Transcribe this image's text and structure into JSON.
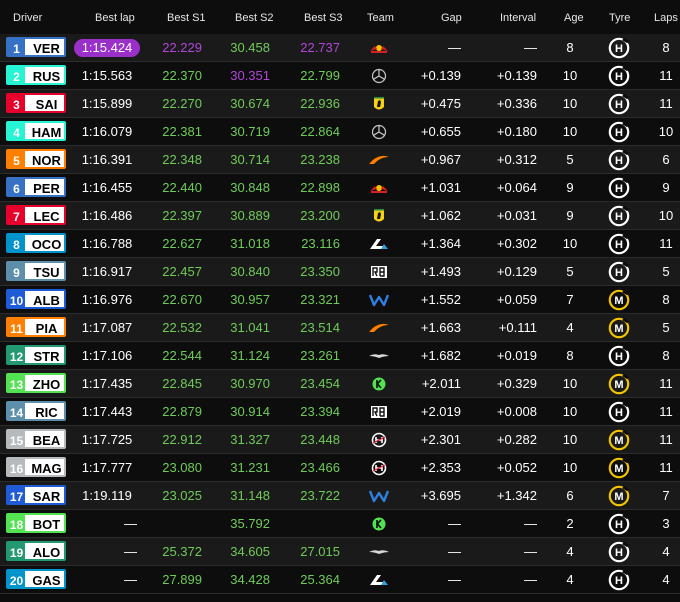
{
  "headers": {
    "driver": "Driver",
    "best_lap": "Best lap",
    "best_s1": "Best S1",
    "best_s2": "Best S2",
    "best_s3": "Best S3",
    "team": "Team",
    "gap": "Gap",
    "interval": "Interval",
    "age": "Age",
    "tyre": "Tyre",
    "laps": "Laps"
  },
  "team_colors": {
    "red_bull": "#3671c6",
    "mercedes": "#27f4d2",
    "ferrari": "#e8002d",
    "mclaren": "#ff8000",
    "alpine": "#0093cc",
    "rb": "#5e8faa",
    "williams": "#1f5bd6",
    "aston_martin": "#229971",
    "kick_sauber": "#52e252",
    "haas": "#b6babd"
  },
  "sector_colors": {
    "personal_best": "#6fcb59",
    "overall_best": "#b146d9",
    "normal": "#ffffff"
  },
  "tyre_colors": {
    "H": "#ffffff",
    "M": "#f5c400"
  },
  "rows": [
    {
      "pos": "1",
      "code": "VER",
      "team": "red_bull",
      "best": "1:15.424",
      "best_fastest": true,
      "s1": "22.229",
      "s1c": "overall_best",
      "s2": "30.458",
      "s2c": "personal_best",
      "s3": "22.737",
      "s3c": "overall_best",
      "gap": "—",
      "int": "—",
      "age": "8",
      "tyre": "H",
      "laps": "8"
    },
    {
      "pos": "2",
      "code": "RUS",
      "team": "mercedes",
      "best": "1:15.563",
      "s1": "22.370",
      "s1c": "personal_best",
      "s2": "30.351",
      "s2c": "overall_best",
      "s3": "22.799",
      "s3c": "personal_best",
      "gap": "+0.139",
      "int": "+0.139",
      "age": "10",
      "tyre": "H",
      "laps": "11"
    },
    {
      "pos": "3",
      "code": "SAI",
      "team": "ferrari",
      "best": "1:15.899",
      "s1": "22.270",
      "s1c": "personal_best",
      "s2": "30.674",
      "s2c": "personal_best",
      "s3": "22.936",
      "s3c": "personal_best",
      "gap": "+0.475",
      "int": "+0.336",
      "age": "10",
      "tyre": "H",
      "laps": "11"
    },
    {
      "pos": "4",
      "code": "HAM",
      "team": "mercedes",
      "best": "1:16.079",
      "s1": "22.381",
      "s1c": "personal_best",
      "s2": "30.719",
      "s2c": "personal_best",
      "s3": "22.864",
      "s3c": "personal_best",
      "gap": "+0.655",
      "int": "+0.180",
      "age": "10",
      "tyre": "H",
      "laps": "10"
    },
    {
      "pos": "5",
      "code": "NOR",
      "team": "mclaren",
      "best": "1:16.391",
      "s1": "22.348",
      "s1c": "personal_best",
      "s2": "30.714",
      "s2c": "personal_best",
      "s3": "23.238",
      "s3c": "personal_best",
      "gap": "+0.967",
      "int": "+0.312",
      "age": "5",
      "tyre": "H",
      "laps": "6"
    },
    {
      "pos": "6",
      "code": "PER",
      "team": "red_bull",
      "best": "1:16.455",
      "s1": "22.440",
      "s1c": "personal_best",
      "s2": "30.848",
      "s2c": "personal_best",
      "s3": "22.898",
      "s3c": "personal_best",
      "gap": "+1.031",
      "int": "+0.064",
      "age": "9",
      "tyre": "H",
      "laps": "9"
    },
    {
      "pos": "7",
      "code": "LEC",
      "team": "ferrari",
      "best": "1:16.486",
      "s1": "22.397",
      "s1c": "personal_best",
      "s2": "30.889",
      "s2c": "personal_best",
      "s3": "23.200",
      "s3c": "personal_best",
      "gap": "+1.062",
      "int": "+0.031",
      "age": "9",
      "tyre": "H",
      "laps": "10"
    },
    {
      "pos": "8",
      "code": "OCO",
      "team": "alpine",
      "best": "1:16.788",
      "s1": "22.627",
      "s1c": "personal_best",
      "s2": "31.018",
      "s2c": "personal_best",
      "s3": "23.116",
      "s3c": "personal_best",
      "gap": "+1.364",
      "int": "+0.302",
      "age": "10",
      "tyre": "H",
      "laps": "11"
    },
    {
      "pos": "9",
      "code": "TSU",
      "team": "rb",
      "best": "1:16.917",
      "s1": "22.457",
      "s1c": "personal_best",
      "s2": "30.840",
      "s2c": "personal_best",
      "s3": "23.350",
      "s3c": "personal_best",
      "gap": "+1.493",
      "int": "+0.129",
      "age": "5",
      "tyre": "H",
      "laps": "5"
    },
    {
      "pos": "10",
      "code": "ALB",
      "team": "williams",
      "best": "1:16.976",
      "s1": "22.670",
      "s1c": "personal_best",
      "s2": "30.957",
      "s2c": "personal_best",
      "s3": "23.321",
      "s3c": "personal_best",
      "gap": "+1.552",
      "int": "+0.059",
      "age": "7",
      "tyre": "M",
      "laps": "8"
    },
    {
      "pos": "11",
      "code": "PIA",
      "team": "mclaren",
      "best": "1:17.087",
      "s1": "22.532",
      "s1c": "personal_best",
      "s2": "31.041",
      "s2c": "personal_best",
      "s3": "23.514",
      "s3c": "personal_best",
      "gap": "+1.663",
      "int": "+0.111",
      "age": "4",
      "tyre": "M",
      "laps": "5"
    },
    {
      "pos": "12",
      "code": "STR",
      "team": "aston_martin",
      "best": "1:17.106",
      "s1": "22.544",
      "s1c": "personal_best",
      "s2": "31.124",
      "s2c": "personal_best",
      "s3": "23.261",
      "s3c": "personal_best",
      "gap": "+1.682",
      "int": "+0.019",
      "age": "8",
      "tyre": "H",
      "laps": "8"
    },
    {
      "pos": "13",
      "code": "ZHO",
      "team": "kick_sauber",
      "best": "1:17.435",
      "s1": "22.845",
      "s1c": "personal_best",
      "s2": "30.970",
      "s2c": "personal_best",
      "s3": "23.454",
      "s3c": "personal_best",
      "gap": "+2.011",
      "int": "+0.329",
      "age": "10",
      "tyre": "M",
      "laps": "11"
    },
    {
      "pos": "14",
      "code": "RIC",
      "team": "rb",
      "best": "1:17.443",
      "s1": "22.879",
      "s1c": "personal_best",
      "s2": "30.914",
      "s2c": "personal_best",
      "s3": "23.394",
      "s3c": "personal_best",
      "gap": "+2.019",
      "int": "+0.008",
      "age": "10",
      "tyre": "H",
      "laps": "11"
    },
    {
      "pos": "15",
      "code": "BEA",
      "team": "haas",
      "best": "1:17.725",
      "s1": "22.912",
      "s1c": "personal_best",
      "s2": "31.327",
      "s2c": "personal_best",
      "s3": "23.448",
      "s3c": "personal_best",
      "gap": "+2.301",
      "int": "+0.282",
      "age": "10",
      "tyre": "M",
      "laps": "11"
    },
    {
      "pos": "16",
      "code": "MAG",
      "team": "haas",
      "best": "1:17.777",
      "s1": "23.080",
      "s1c": "personal_best",
      "s2": "31.231",
      "s2c": "personal_best",
      "s3": "23.466",
      "s3c": "personal_best",
      "gap": "+2.353",
      "int": "+0.052",
      "age": "10",
      "tyre": "M",
      "laps": "11"
    },
    {
      "pos": "17",
      "code": "SAR",
      "team": "williams",
      "best": "1:19.119",
      "s1": "23.025",
      "s1c": "personal_best",
      "s2": "31.148",
      "s2c": "personal_best",
      "s3": "23.722",
      "s3c": "personal_best",
      "gap": "+3.695",
      "int": "+1.342",
      "age": "6",
      "tyre": "M",
      "laps": "7"
    },
    {
      "pos": "18",
      "code": "BOT",
      "team": "kick_sauber",
      "best": "—",
      "s1": "",
      "s1c": "personal_best",
      "s2": "35.792",
      "s2c": "personal_best",
      "s3": "",
      "s3c": "personal_best",
      "gap": "—",
      "int": "—",
      "age": "2",
      "tyre": "H",
      "laps": "3"
    },
    {
      "pos": "19",
      "code": "ALO",
      "team": "aston_martin",
      "best": "—",
      "s1": "25.372",
      "s1c": "personal_best",
      "s2": "34.605",
      "s2c": "personal_best",
      "s3": "27.015",
      "s3c": "personal_best",
      "gap": "—",
      "int": "—",
      "age": "4",
      "tyre": "H",
      "laps": "4"
    },
    {
      "pos": "20",
      "code": "GAS",
      "team": "alpine",
      "best": "—",
      "s1": "27.899",
      "s1c": "personal_best",
      "s2": "34.428",
      "s2c": "personal_best",
      "s3": "25.364",
      "s3c": "personal_best",
      "gap": "—",
      "int": "—",
      "age": "4",
      "tyre": "H",
      "laps": "4"
    }
  ]
}
